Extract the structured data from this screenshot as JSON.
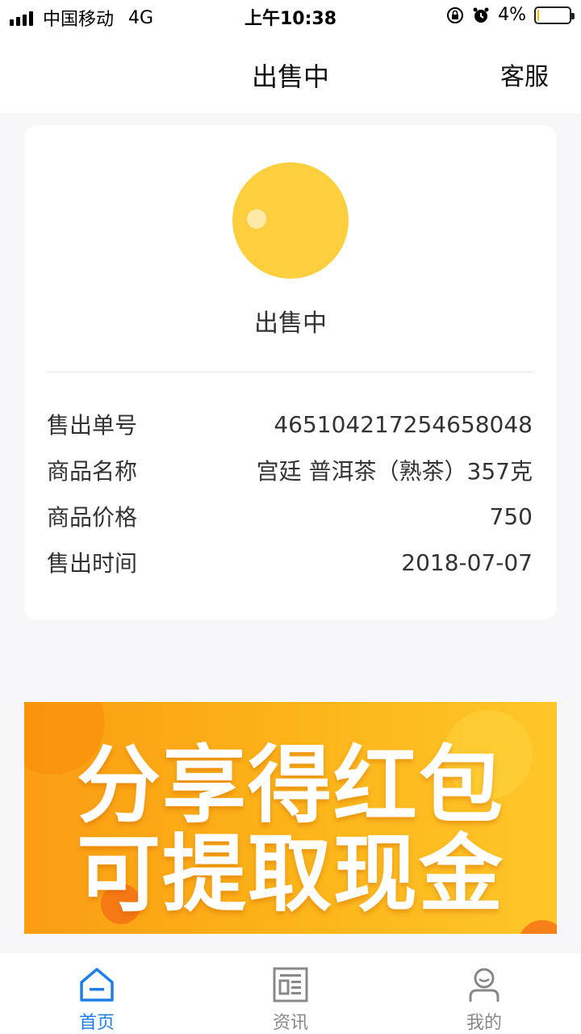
{
  "status_bar": {
    "carrier": "中国移动",
    "network": "4G",
    "time": "上午10:38",
    "battery_percent": "4%",
    "battery_level": 0.04,
    "battery_color": "#f5c000"
  },
  "nav": {
    "title": "出售中",
    "service_label": "客服"
  },
  "card": {
    "status_icon": "status-circle-icon",
    "status_color": "#fdcf3f",
    "status_text": "出售中",
    "rows": [
      {
        "label": "售出单号",
        "value": "465104217254658048"
      },
      {
        "label": "商品名称",
        "value": "宫廷 普洱茶（熟茶）357克"
      },
      {
        "label": "商品价格",
        "value": "750"
      },
      {
        "label": "售出时间",
        "value": "2018-07-07"
      }
    ]
  },
  "banner": {
    "line1": "分享得红包",
    "line2": "可提取现金"
  },
  "tabs": [
    {
      "label": "首页",
      "icon": "home-icon",
      "active": true
    },
    {
      "label": "资讯",
      "icon": "news-icon",
      "active": false
    },
    {
      "label": "我的",
      "icon": "profile-icon",
      "active": false
    }
  ],
  "colors": {
    "accent": "#1f7fe6",
    "inactive": "#888888",
    "banner_orange": "#fcb61a"
  }
}
